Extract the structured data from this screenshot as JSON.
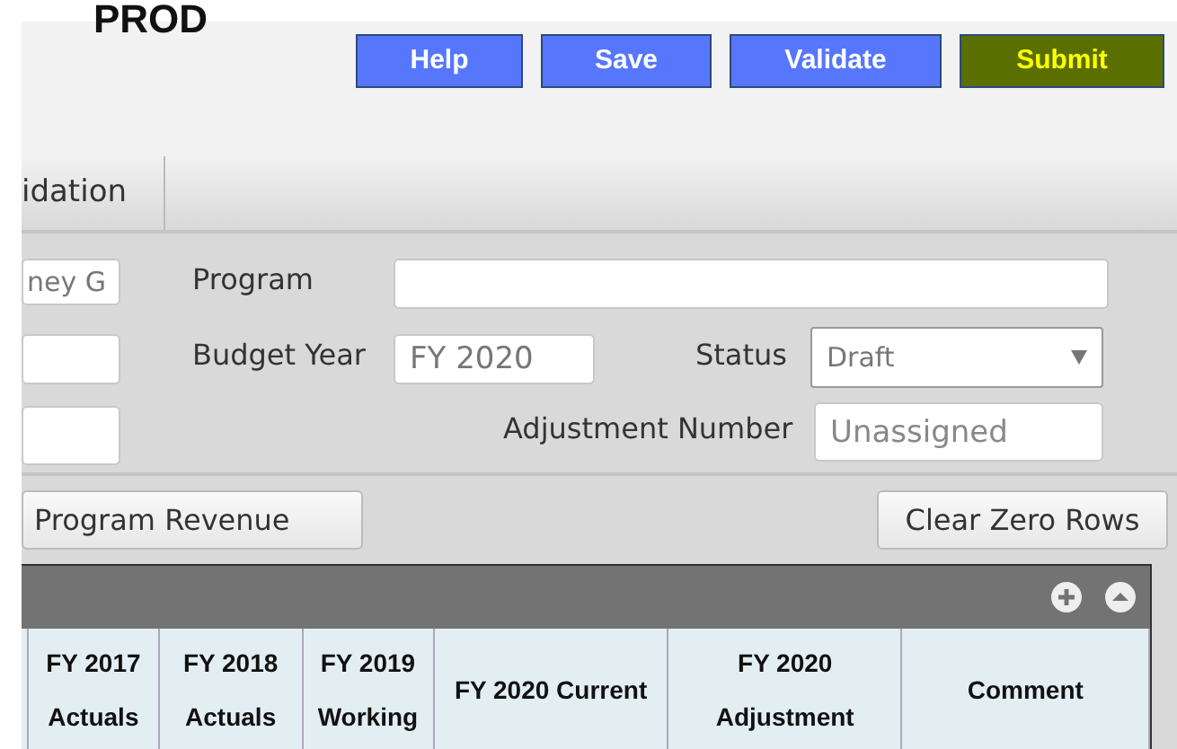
{
  "title": "PROD",
  "buttons": [
    {
      "label": "Help",
      "kind": "plain"
    },
    {
      "label": "Save",
      "kind": "plain"
    },
    {
      "label": "Validate",
      "kind": "plain"
    },
    {
      "label": "Submit",
      "kind": "primary"
    }
  ],
  "tabs": [
    {
      "label": "idation",
      "selected": false
    }
  ],
  "form": {
    "field_1": {
      "value": "ney G"
    },
    "program": {
      "label": "Program"
    },
    "budget_year": {
      "label": "Budget Year",
      "value": "FY 2020"
    },
    "status": {
      "label": "Status",
      "value": "Draft"
    },
    "adjustment_number": {
      "label": "Adjustment Number",
      "placeholder": "Unassigned"
    }
  },
  "actions": [
    "Program Revenue",
    "Clear Zero Rows"
  ],
  "table": {
    "columns": [
      [
        "FY 2017",
        "Actuals"
      ],
      [
        "FY 2018",
        "Actuals"
      ],
      [
        "FY 2019",
        "Working"
      ],
      [
        "FY 2020 Current"
      ],
      [
        "FY 2020",
        "Adjustment"
      ],
      [
        "Comment"
      ]
    ]
  }
}
